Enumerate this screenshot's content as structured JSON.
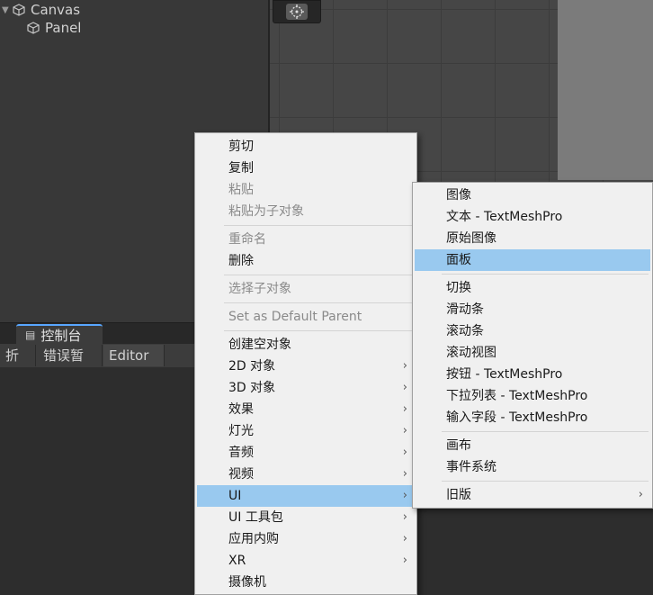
{
  "hierarchy": {
    "items": [
      {
        "label": "Canvas"
      },
      {
        "label": "Panel"
      }
    ]
  },
  "console": {
    "tab_label": "控制台",
    "toolbar": {
      "collapse": "折叠",
      "error_pause": "错误暂停",
      "editor": "Editor ▾"
    }
  },
  "context_menu": {
    "items": [
      {
        "label": "剪切"
      },
      {
        "label": "复制"
      },
      {
        "label": "粘贴"
      },
      {
        "label": "粘贴为子对象"
      },
      {
        "label": "重命名"
      },
      {
        "label": "删除"
      },
      {
        "label": "选择子对象"
      },
      {
        "label": "Set as Default Parent"
      },
      {
        "label": "创建空对象"
      },
      {
        "label": "2D 对象"
      },
      {
        "label": "3D 对象"
      },
      {
        "label": "效果"
      },
      {
        "label": "灯光"
      },
      {
        "label": "音频"
      },
      {
        "label": "视频"
      },
      {
        "label": "UI"
      },
      {
        "label": "UI 工具包"
      },
      {
        "label": "应用内购"
      },
      {
        "label": "XR"
      },
      {
        "label": "摄像机"
      }
    ],
    "submenu_arrow": "›"
  },
  "ui_submenu": {
    "items": [
      {
        "label": "图像"
      },
      {
        "label": "文本 - TextMeshPro"
      },
      {
        "label": "原始图像"
      },
      {
        "label": "面板"
      },
      {
        "label": "切换"
      },
      {
        "label": "滑动条"
      },
      {
        "label": "滚动条"
      },
      {
        "label": "滚动视图"
      },
      {
        "label": "按钮 - TextMeshPro"
      },
      {
        "label": "下拉列表 - TextMeshPro"
      },
      {
        "label": "输入字段 - TextMeshPro"
      },
      {
        "label": "画布"
      },
      {
        "label": "事件系统"
      },
      {
        "label": "旧版"
      }
    ],
    "highlight_color": "#99c9ef"
  }
}
